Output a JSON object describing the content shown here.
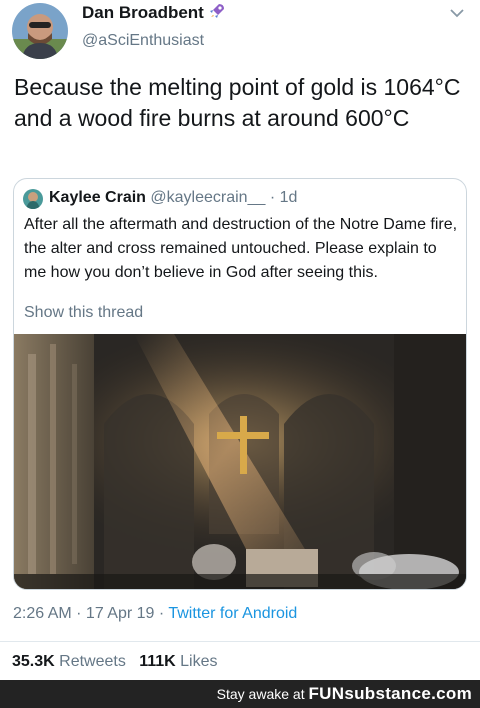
{
  "tweet": {
    "display_name": "Dan Broadbent",
    "name_emoji": "rocket-icon",
    "handle": "@aSciEnthusiast",
    "text": "Because the melting point of gold is 1064°C and a wood fire burns at around 600°C",
    "timestamp": "2:26 AM · 17 Apr 19 · ",
    "source_app": "Twitter for Android",
    "retweets_count": "35.3K",
    "retweets_label": "Retweets",
    "likes_count": "111K",
    "likes_label": "Likes"
  },
  "quoted_tweet": {
    "display_name": "Kaylee Crain",
    "handle": "@kayleecrain__",
    "time": "· 1d",
    "text": "After all the aftermath and destruction of the Notre Dame fire, the alter and cross remained untouched. Please explain to me how you don’t believe in God after seeing this.",
    "show_thread": "Show this thread"
  },
  "footer": {
    "prefix": "Stay awake at ",
    "brand": "FUNsubstance.com"
  },
  "colors": {
    "link_blue": "#1b95e0",
    "secondary_gray": "#657786",
    "border": "#ccd6dd",
    "footer_bg": "#232323"
  }
}
